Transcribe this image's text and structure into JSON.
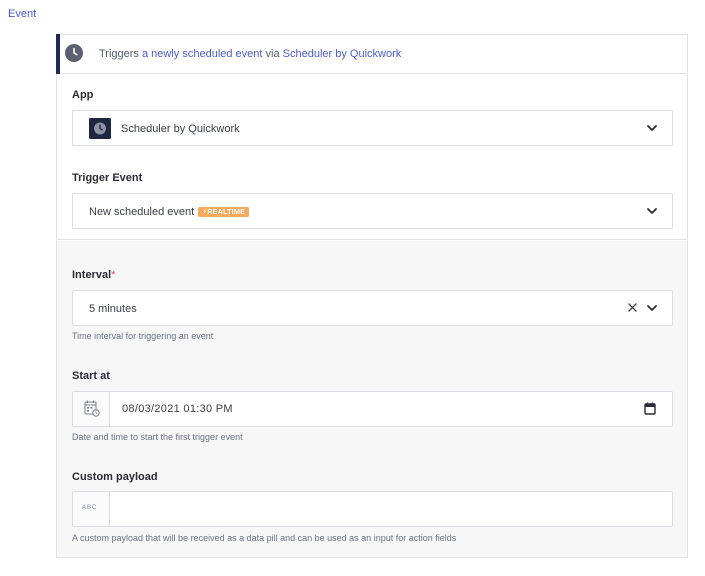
{
  "section": {
    "title": "Event"
  },
  "header": {
    "prefix": "Triggers ",
    "event_link": "a newly scheduled event",
    "via": " via ",
    "app_link": "Scheduler by Quickwork",
    "icon": "clock-icon"
  },
  "app": {
    "label": "App",
    "value": "Scheduler by Quickwork",
    "icon": "clock-icon"
  },
  "trigger_event": {
    "label": "Trigger Event",
    "value": "New scheduled event",
    "badge": "⚡REALTIME"
  },
  "interval": {
    "label": "Interval",
    "required_mark": "*",
    "value": "5 minutes",
    "help": "Time interval for triggering an event"
  },
  "start_at": {
    "label": "Start at",
    "value": "08/03/2021 01:30  PM",
    "help": "Date and time to start the first trigger event"
  },
  "custom_payload": {
    "label": "Custom payload",
    "prefix": "ABC",
    "value": "",
    "help": "A custom payload that will be received as a data pill and can be used as an input for action fields"
  },
  "colors": {
    "link": "#4a5bd6",
    "accent": "#1f2a55",
    "badge": "#f6a95b",
    "required": "#e05353"
  }
}
